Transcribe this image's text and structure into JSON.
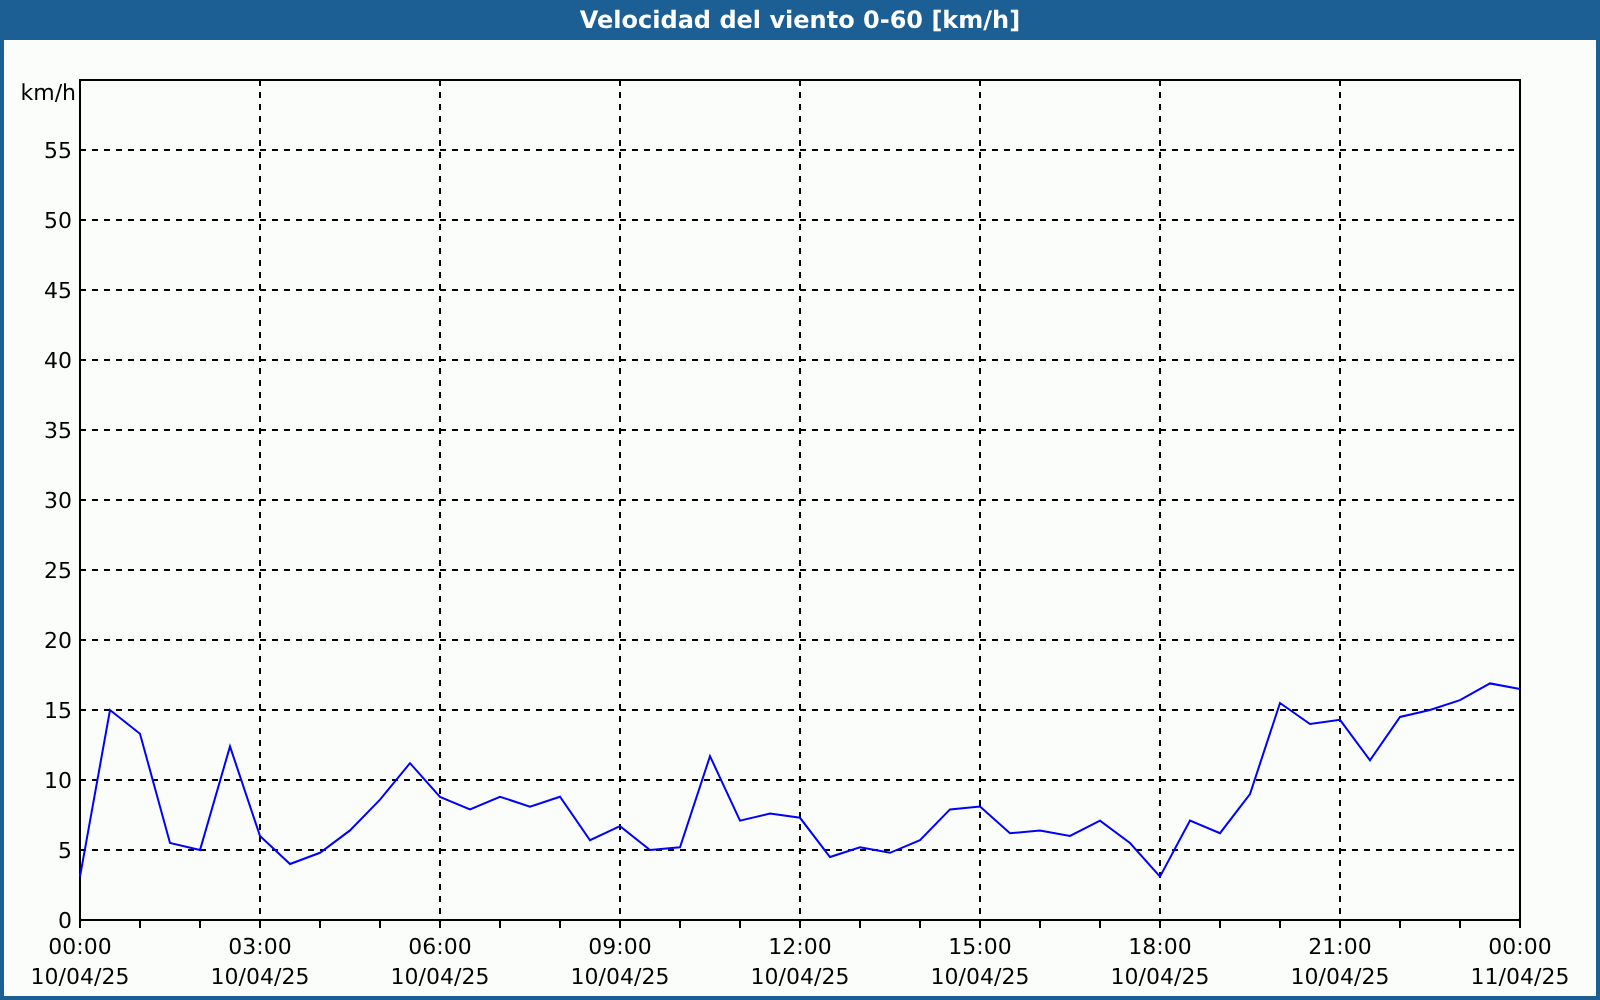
{
  "window": {
    "title": "Velocidad del viento 0-60 [km/h]"
  },
  "chart_data": {
    "type": "line",
    "ylabel": "km/h",
    "ylim": [
      0,
      60
    ],
    "grid": true,
    "categories": [
      "00:00\n10/04/25",
      null,
      null,
      null,
      null,
      null,
      "03:00\n10/04/25",
      null,
      null,
      null,
      null,
      null,
      "06:00\n10/04/25",
      null,
      null,
      null,
      null,
      null,
      "09:00\n10/04/25",
      null,
      null,
      null,
      null,
      null,
      "12:00\n10/04/25",
      null,
      null,
      null,
      null,
      null,
      "15:00\n10/04/25",
      null,
      null,
      null,
      null,
      null,
      "18:00\n10/04/25",
      null,
      null,
      null,
      null,
      null,
      "21:00\n10/04/25",
      null,
      null,
      null,
      null,
      null,
      "00:00\n11/04/25"
    ],
    "series": [
      {
        "color": "#0000ff",
        "values": [
          3.1,
          15,
          13.3,
          5.5,
          5,
          12.4,
          6,
          4,
          4.8,
          6.4,
          8.6,
          11.2,
          8.8,
          7.9,
          8.8,
          8.1,
          8.8,
          5.7,
          6.7,
          5,
          5.2,
          11.7,
          7.1,
          7.6,
          7.3,
          4.5,
          5.2,
          4.8,
          5.7,
          7.9,
          8.1,
          6.2,
          6.4,
          6,
          7.1,
          5.5,
          3.1,
          7.1,
          6.2,
          9,
          15.5,
          14,
          14.3,
          11.4,
          14.5,
          15,
          15.7,
          16.9,
          16.5
        ]
      }
    ],
    "yticks": [
      0,
      5,
      10,
      15,
      20,
      25,
      30,
      35,
      40,
      45,
      50,
      55
    ]
  }
}
